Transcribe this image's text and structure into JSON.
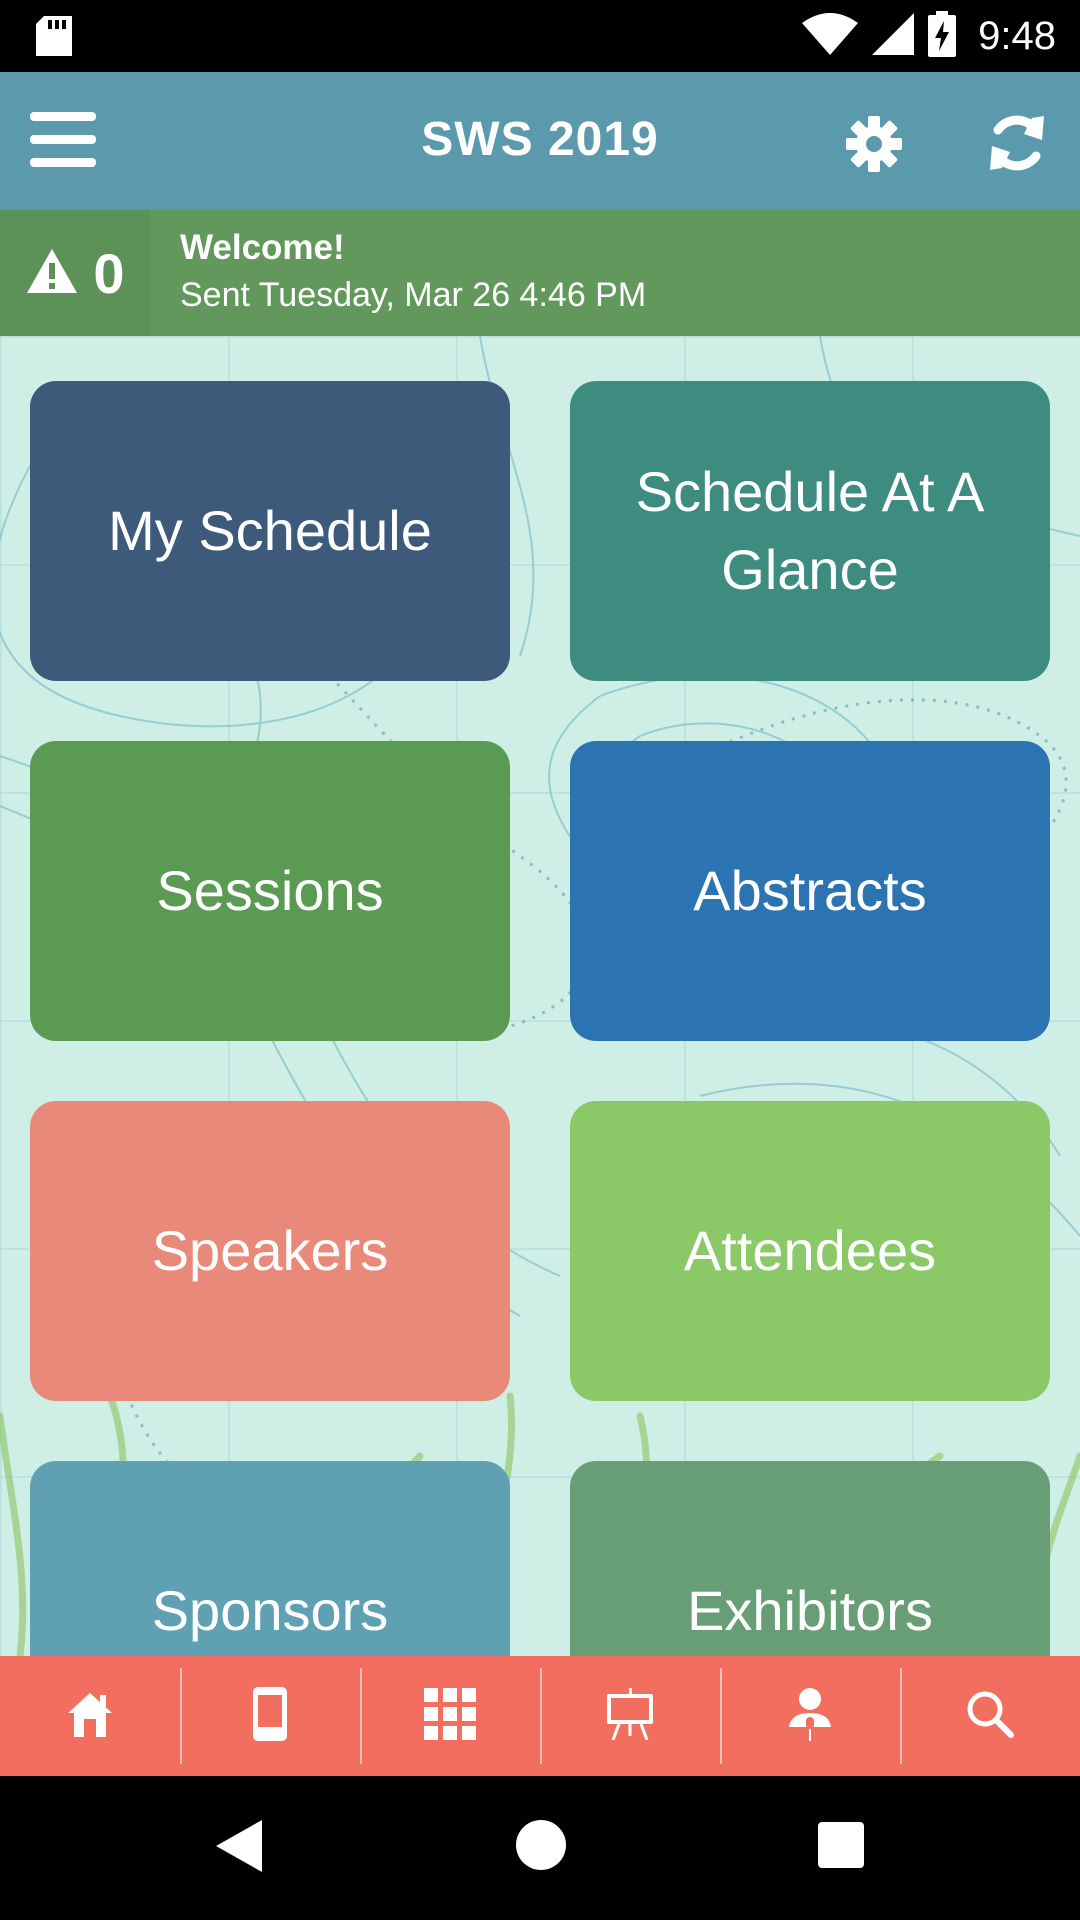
{
  "status_bar": {
    "time": "9:48",
    "icons": [
      "sd-card-icon",
      "wifi-icon",
      "signal-icon",
      "battery-charging-icon"
    ]
  },
  "header": {
    "title": "SWS 2019",
    "left_icon": "menu-icon",
    "right_icons": [
      "gear-icon",
      "refresh-icon"
    ],
    "background_color": "#5b9aac"
  },
  "notification": {
    "alert_count": "0",
    "title": "Welcome!",
    "subtitle": "Sent Tuesday, Mar 26 4:46 PM",
    "icon": "warning-icon",
    "background_color": "#62985c"
  },
  "tiles": [
    {
      "label": "My Schedule",
      "color": "#3e5a7b"
    },
    {
      "label": "Schedule At A Glance",
      "color": "#3e8c80"
    },
    {
      "label": "Sessions",
      "color": "#5a9a52"
    },
    {
      "label": "Abstracts",
      "color": "#2b73b1"
    },
    {
      "label": "Speakers",
      "color": "#e8897a"
    },
    {
      "label": "Attendees",
      "color": "#8ac868"
    },
    {
      "label": "Sponsors",
      "color": "#5fa1b3"
    },
    {
      "label": "Exhibitors",
      "color": "#689e75"
    }
  ],
  "tab_bar": {
    "background_color": "#f26f5f",
    "tabs": [
      "home-icon",
      "mobile-device-icon",
      "grid-icon",
      "presentation-board-icon",
      "speaker-icon",
      "search-icon"
    ]
  },
  "nav_bar": {
    "buttons": [
      "back-icon",
      "home-circle-icon",
      "recents-icon"
    ]
  }
}
